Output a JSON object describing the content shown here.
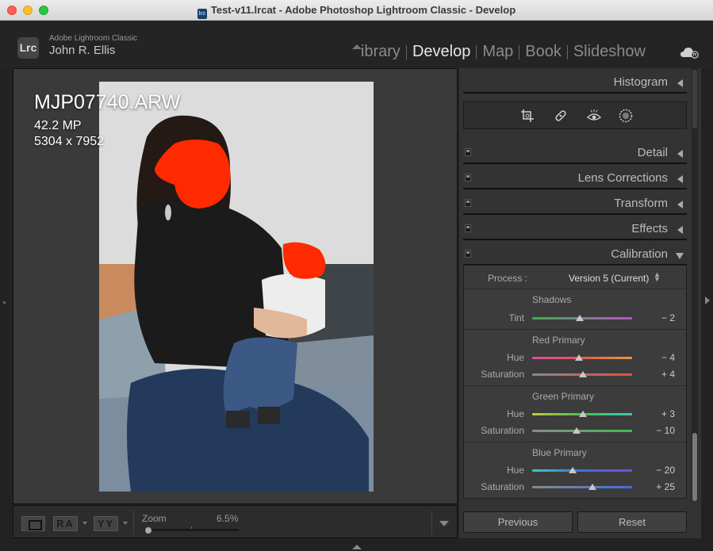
{
  "window": {
    "title": "Test-v11.lrcat - Adobe Photoshop Lightroom Classic - Develop",
    "doc_icon": "lrc"
  },
  "identity": {
    "logo": "Lrc",
    "app_name": "Adobe Lightroom Classic",
    "user_name": "John R. Ellis",
    "modules": [
      "ibrary",
      "Develop",
      "Map",
      "Book",
      "Slideshow"
    ],
    "active_module": "Develop"
  },
  "photo_info": {
    "filename": "MJP07740.ARW",
    "megapixels": "42.2 MP",
    "dimensions": "5304 x 7952"
  },
  "toolbar": {
    "zoom_label": "Zoom",
    "zoom_value": "6.5%",
    "ra_label": "RA",
    "yy_label": "YY"
  },
  "panels": {
    "histogram": "Histogram",
    "detail": "Detail",
    "lens": "Lens Corrections",
    "transform": "Transform",
    "effects": "Effects",
    "calibration": "Calibration"
  },
  "calibration": {
    "process_label": "Process :",
    "process_value": "Version 5 (Current)",
    "shadows": {
      "title": "Shadows",
      "tint_label": "Tint",
      "tint_value": "− 2"
    },
    "red": {
      "title": "Red Primary",
      "hue_label": "Hue",
      "hue_value": "− 4",
      "sat_label": "Saturation",
      "sat_value": "+ 4"
    },
    "green": {
      "title": "Green Primary",
      "hue_label": "Hue",
      "hue_value": "+ 3",
      "sat_label": "Saturation",
      "sat_value": "− 10"
    },
    "blue": {
      "title": "Blue Primary",
      "hue_label": "Hue",
      "hue_value": "− 20",
      "sat_label": "Saturation",
      "sat_value": "+ 25"
    }
  },
  "buttons": {
    "previous": "Previous",
    "reset": "Reset"
  },
  "colors": {
    "accent": "#e6e6e6",
    "panel_bg": "#333333",
    "redaction": "#ff2a00"
  }
}
